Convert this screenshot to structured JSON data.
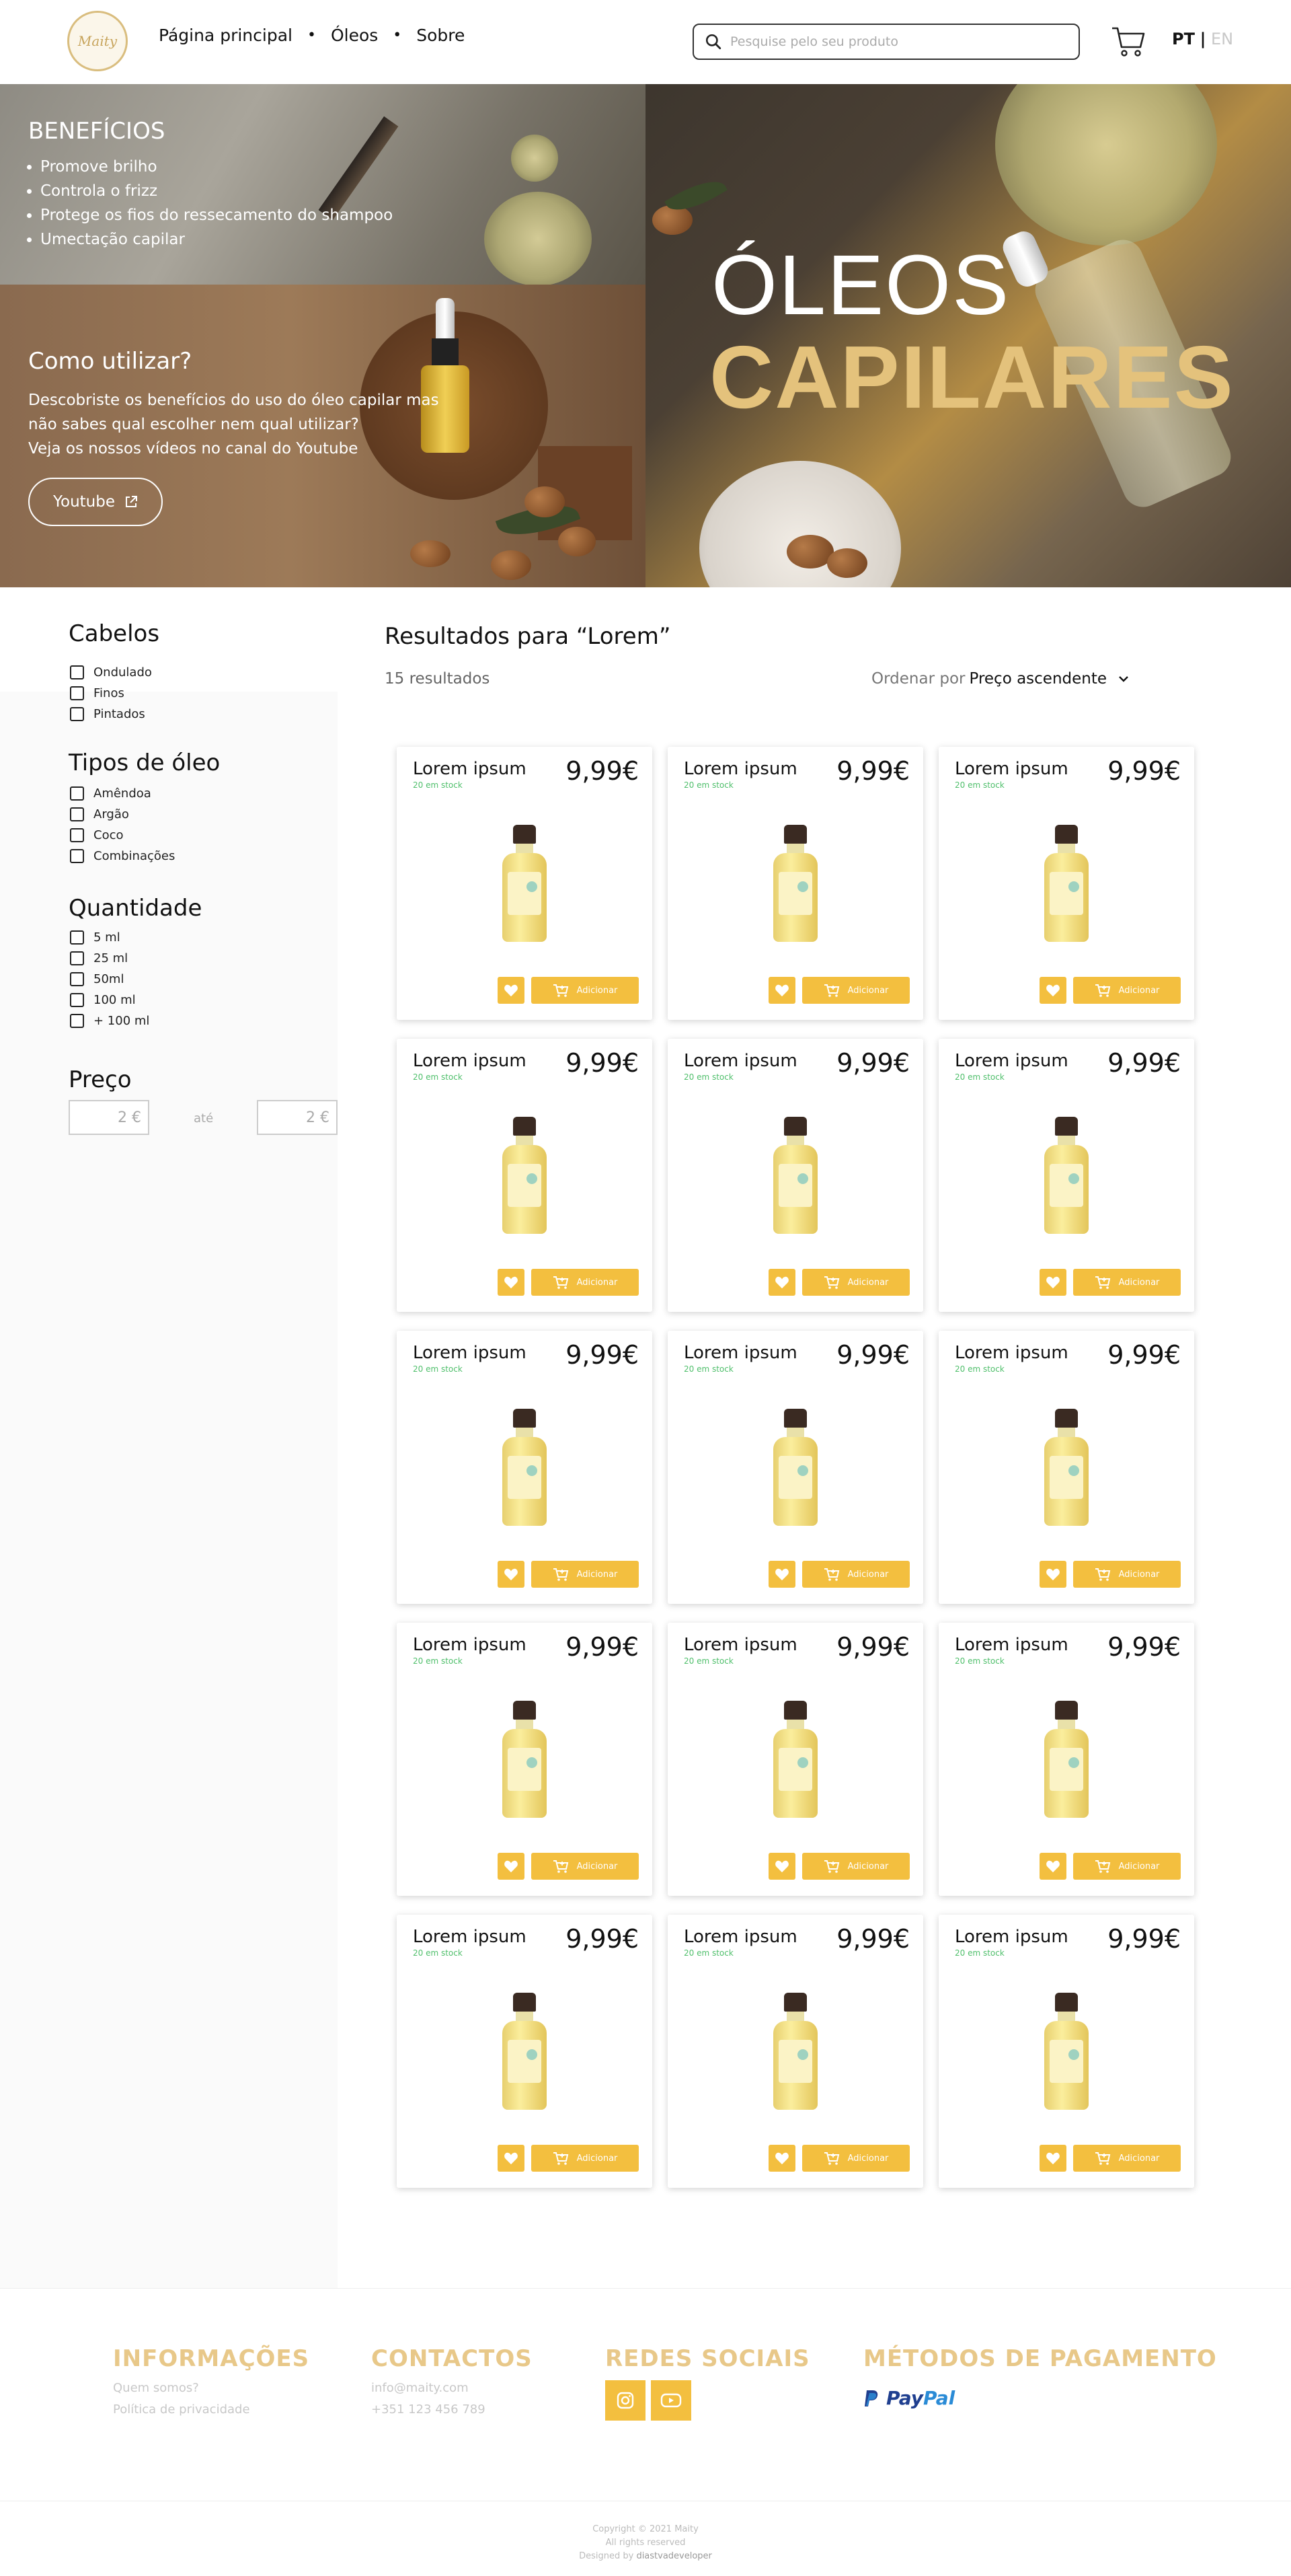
{
  "header": {
    "logo_text": "Maity",
    "nav": [
      "Página principal",
      "Óleos",
      "Sobre"
    ],
    "search_placeholder": "Pesquise pelo seu produto",
    "lang_pt": "PT",
    "lang_sep": "|",
    "lang_en": "EN"
  },
  "hero": {
    "benefits_title": "BENEFÍCIOS",
    "benefits": [
      "Promove brilho",
      "Controla o frizz",
      "Protege os fios do ressecamento do shampoo",
      "Umectação capilar"
    ],
    "how_title": "Como utilizar?",
    "how_text": [
      "Descobriste os benefícios do uso do óleo capilar mas",
      "não sabes qual escolher nem qual utilizar?",
      "Veja os nossos vídeos no canal do Youtube"
    ],
    "youtube_button": "Youtube",
    "headline_1": "ÓLEOS",
    "headline_2": "CAPILARES"
  },
  "filters": {
    "hair_title": "Cabelos",
    "hair": [
      "Ondulado",
      "Finos",
      "Pintados"
    ],
    "oil_title": "Tipos de óleo",
    "oils": [
      "Amêndoa",
      "Argão",
      "Coco",
      "Combinações"
    ],
    "qty_title": "Quantidade",
    "quantities": [
      "5 ml",
      "25 ml",
      "50ml",
      "100 ml",
      "+ 100 ml"
    ],
    "price_title": "Preço",
    "price_min": "2 €",
    "price_sep": "até",
    "price_max": "2 €"
  },
  "results": {
    "title": "Resultados para “Lorem”",
    "count": "15 resultados",
    "sort_label": "Ordenar por",
    "sort_value": "Preço ascendente"
  },
  "product": {
    "name": "Lorem ipsum",
    "stock": "20 em stock",
    "price": "9,99€",
    "add_label": "Adicionar"
  },
  "footer": {
    "info_title": "INFORMAÇÕES",
    "info_links": [
      "Quem somos?",
      "Política de privacidade"
    ],
    "contacts_title": "CONTACTOS",
    "contacts": [
      "info@maity.com",
      "+351 123 456 789"
    ],
    "social_title": "REDES SOCIAIS",
    "payment_title": "MÉTODOS DE PAGAMENTO",
    "paypal_a": "Pay",
    "paypal_b": "Pal",
    "copyright": "Copyright © 2021 Maity",
    "rights": "All rights reserved",
    "designed_by": "Designed by",
    "designer": "diastvadeveloper"
  },
  "colors": {
    "accent": "#f3bf3f",
    "footer_heading": "#e8c889",
    "stock_green": "#4fbf6b",
    "hero_gold": "#e4c27c"
  },
  "icons": [
    "search-icon",
    "cart-icon",
    "external-link-icon",
    "heart-icon",
    "add-to-cart-icon",
    "instagram-icon",
    "youtube-icon",
    "paypal-icon",
    "chevron-down-icon"
  ]
}
